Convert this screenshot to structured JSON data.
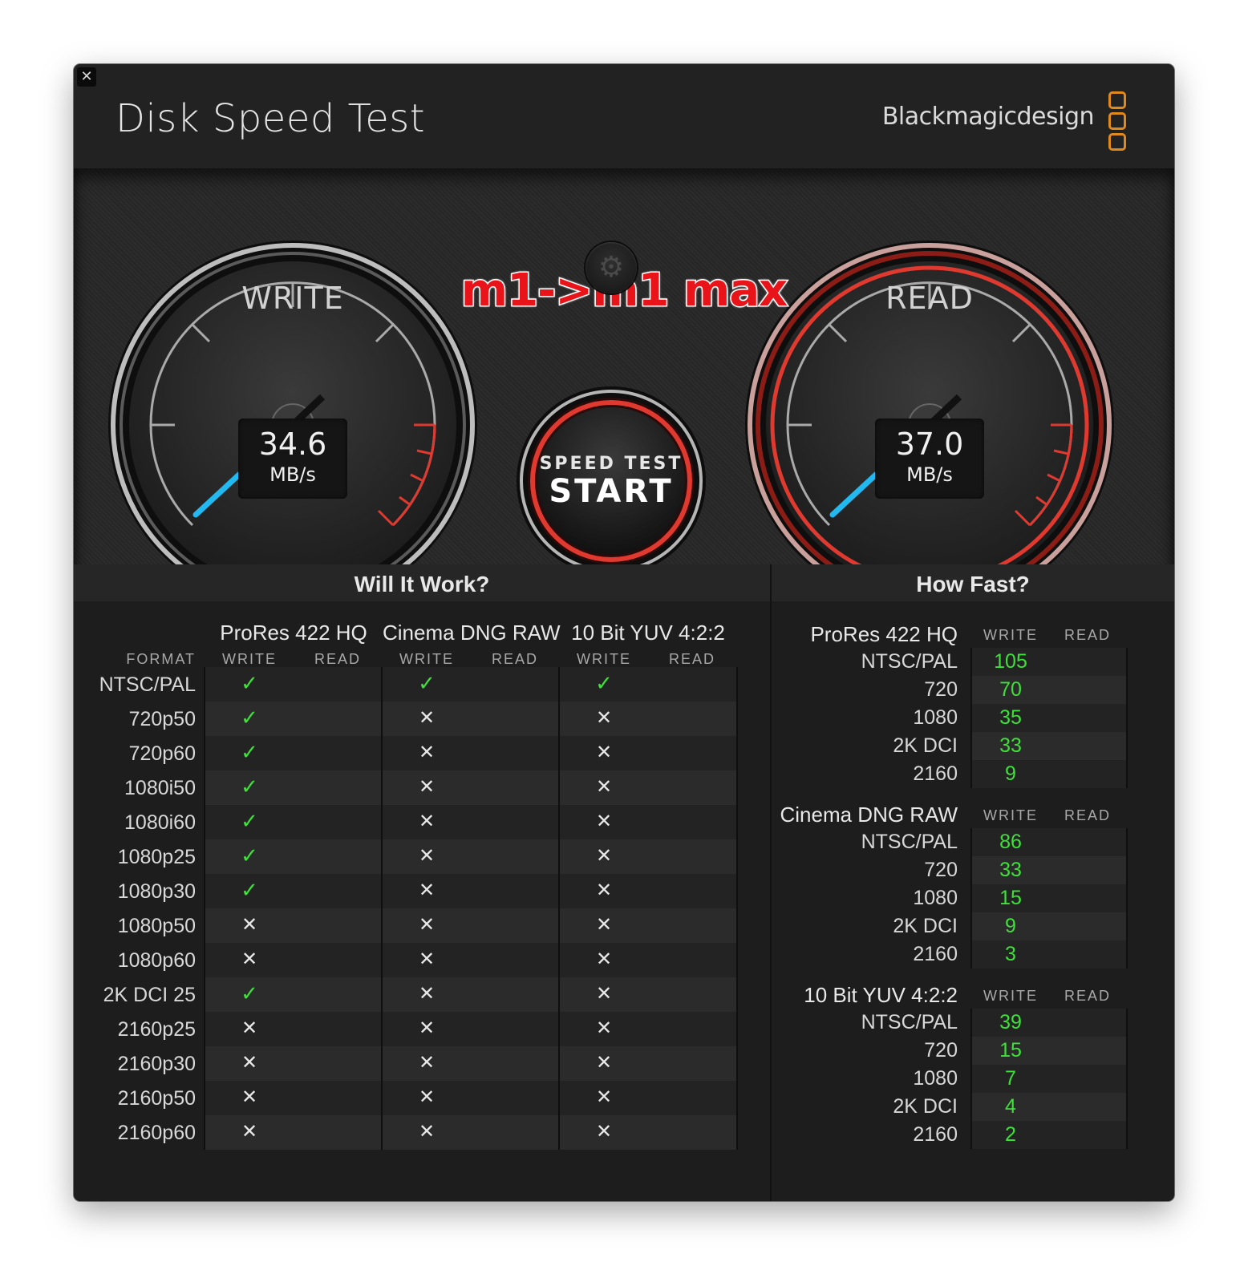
{
  "app": {
    "title": "Disk Speed Test",
    "brand": "Blackmagicdesign",
    "close_glyph": "✕",
    "accent_orange": "#e08a1e"
  },
  "annotation": "m1->m1 max",
  "gauges": {
    "write": {
      "label": "WRITE",
      "value": "34.6",
      "unit": "MB/s"
    },
    "read": {
      "label": "READ",
      "value": "37.0",
      "unit": "MB/s"
    }
  },
  "settings_icon": "gear-icon",
  "start_button": {
    "line1": "SPEED TEST",
    "line2": "START"
  },
  "will_it_work": {
    "title": "Will It Work?",
    "format_header": "FORMAT",
    "write_label": "WRITE",
    "read_label": "READ",
    "codecs": [
      "ProRes 422 HQ",
      "Cinema DNG RAW",
      "10 Bit YUV 4:2:2"
    ],
    "rows": [
      {
        "format": "NTSC/PAL",
        "write": [
          true,
          true,
          true
        ]
      },
      {
        "format": "720p50",
        "write": [
          true,
          false,
          false
        ]
      },
      {
        "format": "720p60",
        "write": [
          true,
          false,
          false
        ]
      },
      {
        "format": "1080i50",
        "write": [
          true,
          false,
          false
        ]
      },
      {
        "format": "1080i60",
        "write": [
          true,
          false,
          false
        ]
      },
      {
        "format": "1080p25",
        "write": [
          true,
          false,
          false
        ]
      },
      {
        "format": "1080p30",
        "write": [
          true,
          false,
          false
        ]
      },
      {
        "format": "1080p50",
        "write": [
          false,
          false,
          false
        ]
      },
      {
        "format": "1080p60",
        "write": [
          false,
          false,
          false
        ]
      },
      {
        "format": "2K DCI 25",
        "write": [
          true,
          false,
          false
        ]
      },
      {
        "format": "2160p25",
        "write": [
          false,
          false,
          false
        ]
      },
      {
        "format": "2160p30",
        "write": [
          false,
          false,
          false
        ]
      },
      {
        "format": "2160p50",
        "write": [
          false,
          false,
          false
        ]
      },
      {
        "format": "2160p60",
        "write": [
          false,
          false,
          false
        ]
      }
    ],
    "yes_glyph": "✓",
    "no_glyph": "✕",
    "yes_color": "#3fe03a"
  },
  "how_fast": {
    "title": "How Fast?",
    "write_label": "WRITE",
    "read_label": "READ",
    "groups": [
      {
        "name": "ProRes 422 HQ",
        "rows": [
          {
            "label": "NTSC/PAL",
            "write": "105"
          },
          {
            "label": "720",
            "write": "70"
          },
          {
            "label": "1080",
            "write": "35"
          },
          {
            "label": "2K DCI",
            "write": "33"
          },
          {
            "label": "2160",
            "write": "9"
          }
        ]
      },
      {
        "name": "Cinema DNG RAW",
        "rows": [
          {
            "label": "NTSC/PAL",
            "write": "86"
          },
          {
            "label": "720",
            "write": "33"
          },
          {
            "label": "1080",
            "write": "15"
          },
          {
            "label": "2K DCI",
            "write": "9"
          },
          {
            "label": "2160",
            "write": "3"
          }
        ]
      },
      {
        "name": "10 Bit YUV 4:2:2",
        "rows": [
          {
            "label": "NTSC/PAL",
            "write": "39"
          },
          {
            "label": "720",
            "write": "15"
          },
          {
            "label": "1080",
            "write": "7"
          },
          {
            "label": "2K DCI",
            "write": "4"
          },
          {
            "label": "2160",
            "write": "2"
          }
        ]
      }
    ]
  }
}
